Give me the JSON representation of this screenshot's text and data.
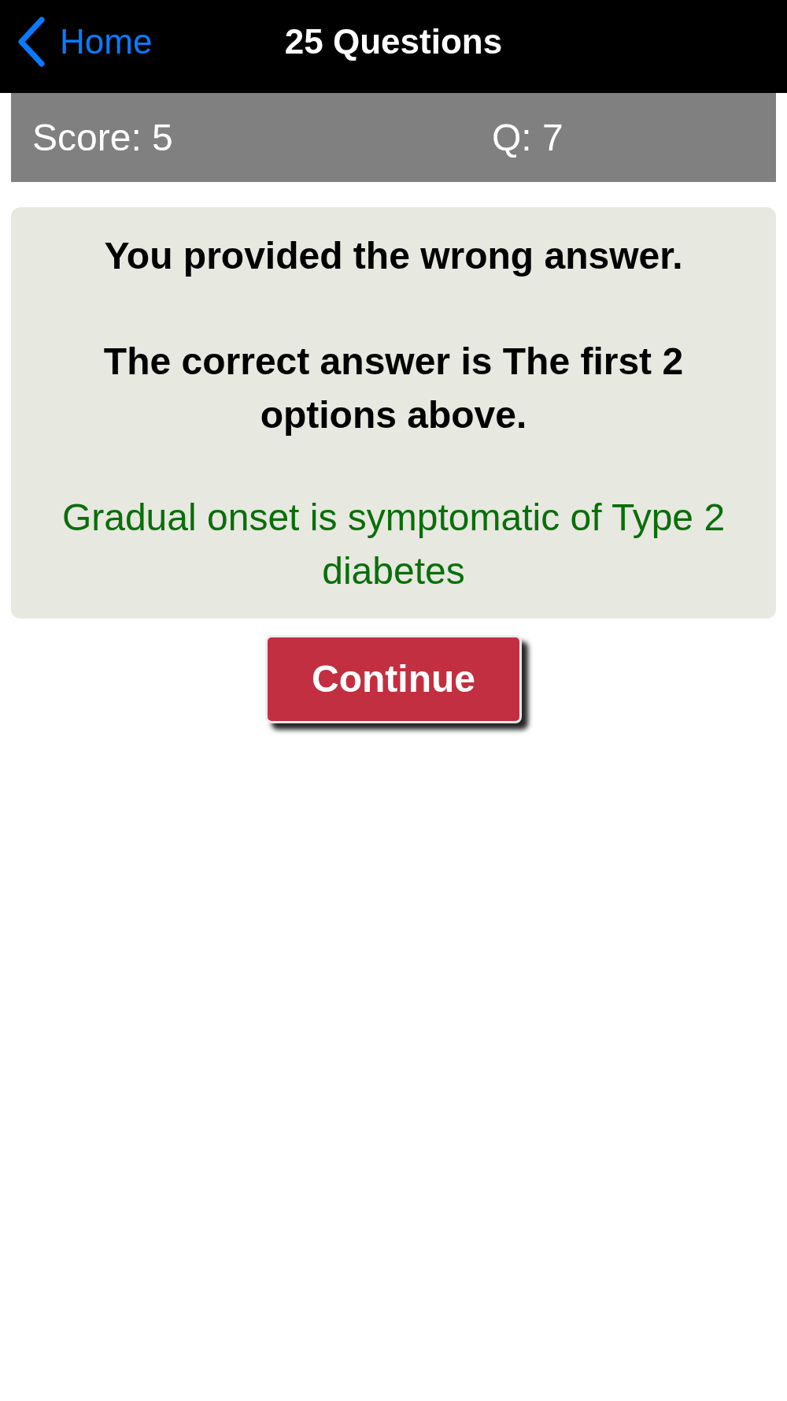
{
  "nav_bar": {
    "back_button": {
      "label": "Home"
    },
    "title": "25 Questions"
  },
  "score_bar": {
    "score": "Score: 5",
    "question": "Q: 7"
  },
  "feedback_card": {
    "result": "You provided the wrong answer.",
    "correct_answer": "The correct answer is The first 2 options above.",
    "explanation": "Gradual onset is symptomatic of Type 2 diabetes"
  },
  "buttons": [
    {
      "label": "Continue"
    }
  ]
}
